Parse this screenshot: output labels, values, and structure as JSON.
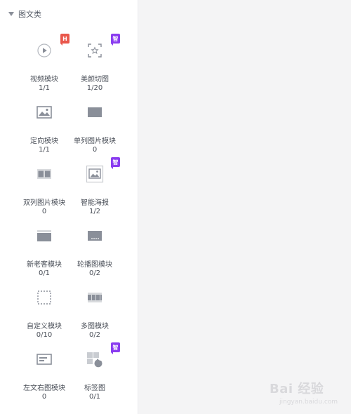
{
  "section": {
    "title": "图文类"
  },
  "tiles": [
    {
      "label": "视频模块",
      "count": "1/1",
      "icon": "video-play-icon",
      "badge": "H"
    },
    {
      "label": "美颜切图",
      "count": "1/20",
      "icon": "beauty-crop-icon",
      "badge": "智"
    },
    {
      "label": "定向模块",
      "count": "1/1",
      "icon": "directional-image-icon"
    },
    {
      "label": "单列图片模块",
      "count": "0",
      "icon": "single-column-image-icon"
    },
    {
      "label": "双列图片模块",
      "count": "0",
      "icon": "double-column-image-icon"
    },
    {
      "label": "智能海报",
      "count": "1/2",
      "icon": "smart-poster-icon",
      "badge": "智"
    },
    {
      "label": "新老客模块",
      "count": "0/1",
      "icon": "customer-module-icon"
    },
    {
      "label": "轮播图模块",
      "count": "0/2",
      "icon": "carousel-icon"
    },
    {
      "label": "自定义模块",
      "count": "0/10",
      "icon": "custom-dashed-icon"
    },
    {
      "label": "多图模块",
      "count": "0/2",
      "icon": "multi-image-icon"
    },
    {
      "label": "左文右图模块",
      "count": "0",
      "icon": "text-left-image-right-icon"
    },
    {
      "label": "标签图",
      "count": "0/1",
      "icon": "tag-image-icon",
      "badge": "智"
    }
  ],
  "watermark": {
    "text": "Bai 经验",
    "sub": "jingyan.baidu.com"
  },
  "colors": {
    "icon": "#8a8f99",
    "hot_badge": "#e9574b",
    "smart_badge": "#8a3cf0"
  }
}
